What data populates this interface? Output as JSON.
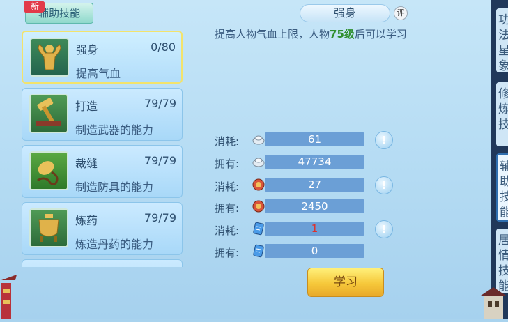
{
  "tab": {
    "label": "辅助技能",
    "badge": "新"
  },
  "skills": [
    {
      "name": "强身",
      "level": "0/80",
      "desc": "提高气血",
      "icon": "muscle-icon"
    },
    {
      "name": "打造",
      "level": "79/79",
      "desc": "制造武器的能力",
      "icon": "hammer-icon"
    },
    {
      "name": "裁缝",
      "level": "79/79",
      "desc": "制造防具的能力",
      "icon": "needle-thread-icon"
    },
    {
      "name": "炼药",
      "level": "79/79",
      "desc": "炼造丹药的能力",
      "icon": "cauldron-icon"
    }
  ],
  "detail": {
    "title": "强身",
    "rate_label": "评",
    "desc_before": "提高人物气血上限，人物",
    "desc_highlight": "75级",
    "desc_after": "后可以学习"
  },
  "resources": [
    {
      "label": "消耗:",
      "icon": "silver-icon",
      "value": "61"
    },
    {
      "label": "拥有:",
      "icon": "silver-icon",
      "value": "47734"
    },
    {
      "label": "消耗:",
      "icon": "contribution-icon",
      "value": "27"
    },
    {
      "label": "拥有:",
      "icon": "contribution-icon",
      "value": "2450"
    },
    {
      "label": "消耗:",
      "icon": "scroll-icon",
      "value": "1"
    },
    {
      "label": "拥有:",
      "icon": "scroll-icon",
      "value": "0"
    }
  ],
  "learn_button": "学习",
  "side_tabs": [
    "功法星象",
    "修炼技",
    "辅助技能",
    "居情技能"
  ],
  "colors": {
    "highlight": "#2f8f2f",
    "shortage": "#e0302a",
    "button": "#f6c83a"
  }
}
